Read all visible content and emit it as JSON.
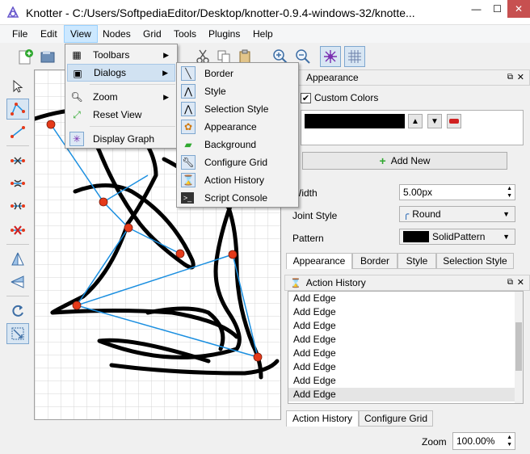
{
  "window": {
    "title": "Knotter - C:/Users/SoftpediaEditor/Desktop/knotter-0.9.4-windows-32/knotte...",
    "minimize": "—",
    "maximize": "☐",
    "close": "✕"
  },
  "menubar": [
    "File",
    "Edit",
    "View",
    "Nodes",
    "Grid",
    "Tools",
    "Plugins",
    "Help"
  ],
  "view_menu": {
    "items": [
      {
        "label": "Toolbars",
        "icon": "toolbars-icon",
        "submenu": true
      },
      {
        "label": "Dialogs",
        "icon": "dialogs-icon",
        "submenu": true
      },
      {
        "label": "Zoom",
        "icon": "zoom-icon",
        "submenu": true
      },
      {
        "label": "Reset View",
        "icon": "reset-view-icon",
        "submenu": false
      },
      {
        "label": "Display Graph",
        "icon": "display-graph-icon",
        "submenu": false
      }
    ]
  },
  "dialogs_menu": {
    "items": [
      {
        "label": "Border",
        "icon": "border-icon"
      },
      {
        "label": "Style",
        "icon": "style-icon"
      },
      {
        "label": "Selection Style",
        "icon": "selection-style-icon"
      },
      {
        "label": "Appearance",
        "icon": "appearance-icon"
      },
      {
        "label": "Background",
        "icon": "background-icon"
      },
      {
        "label": "Configure Grid",
        "icon": "configure-grid-icon"
      },
      {
        "label": "Action History",
        "icon": "action-history-icon"
      },
      {
        "label": "Script Console",
        "icon": "script-console-icon"
      }
    ]
  },
  "appearance_panel": {
    "title": "Appearance",
    "custom_colors_label": "Custom Colors",
    "custom_colors_checked": true,
    "color_swatch": "#000000",
    "add_new": "Add New",
    "width_label": "Width",
    "width_value": "5.00px",
    "joint_style_label": "Joint Style",
    "joint_style_value": "Round",
    "pattern_label": "Pattern",
    "pattern_value": "SolidPattern",
    "tabs": [
      "Appearance",
      "Border",
      "Style",
      "Selection Style"
    ]
  },
  "history_panel": {
    "title": "Action History",
    "rows": [
      "Add Edge",
      "Add Edge",
      "Add Edge",
      "Add Edge",
      "Add Edge",
      "Add Edge",
      "Add Edge",
      "Add Edge"
    ],
    "tabs": [
      "Action History",
      "Configure Grid"
    ]
  },
  "status": {
    "zoom_label": "Zoom",
    "zoom_value": "100.00%"
  },
  "colors": {
    "node": "#e53a1a",
    "edge": "#1b8fe0",
    "knot": "#000000",
    "accent": "#0078d7"
  }
}
